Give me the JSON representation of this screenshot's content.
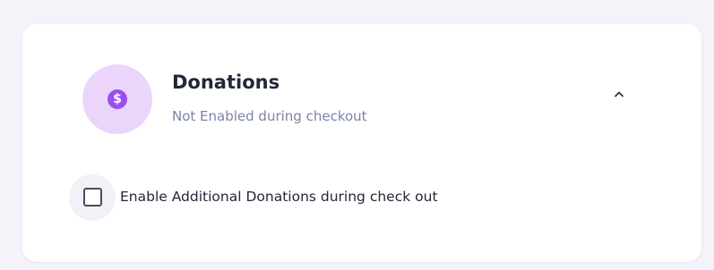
{
  "section": {
    "title": "Donations",
    "status": "Not Enabled during checkout",
    "icon": "dollar-coin-icon",
    "icon_glyph": "$",
    "expanded": true
  },
  "option": {
    "label": "Enable Additional Donations during check out",
    "checked": false
  },
  "colors": {
    "accent": "#9b4ff0",
    "icon_bg": "#ecd5fb",
    "title": "#232838",
    "subtitle": "#7c83a8",
    "page_bg": "#f3f3f9"
  }
}
